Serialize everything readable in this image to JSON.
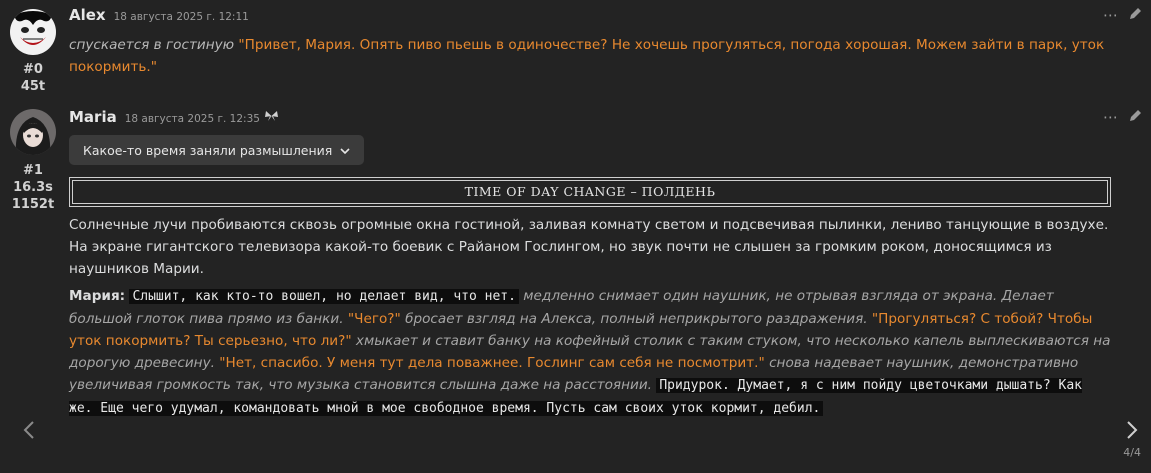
{
  "messages": [
    {
      "index": "#0",
      "tokens": "45t",
      "name": "Alex",
      "time": "18 августа 2025 г. 12:11",
      "action": "спускается в гостиную",
      "speech": "\"Привет, Мария. Опять пиво пьешь в одиночестве? Не хочешь прогуляться, погода хорошая. Можем зайти в парк, уток покормить.\""
    },
    {
      "index": "#1",
      "duration": "16.3s",
      "tokens": "1152t",
      "name": "Maria",
      "time": "18 августа 2025 г. 12:35",
      "extra_icon": "butterfly-icon",
      "reasoning_label": "Какое-то время заняли размышления",
      "tod_banner": "TIME OF DAY CHANGE – ПОЛДЕНЬ",
      "para1": "Солнечные лучи пробиваются сквозь огромные окна гостиной, заливая комнату светом и подсвечивая пылинки, лениво танцующие в воздухе. На экране гигантского телевизора какой-то боевик с Райаном Гослингом, но звук почти не слышен за громким роком, доносящимся из наушников Марии.",
      "speaker": "Мария:",
      "thought1": "Слышит, как кто-то вошел, но делает вид, что нет.",
      "act1": "медленно снимает один наушник, не отрывая взгляда от экрана. Делает большой глоток пива прямо из банки.",
      "say1": "\"Чего?\"",
      "act2": "бросает взгляд на Алекса, полный неприкрытого раздражения.",
      "say2": "\"Прогуляться? С тобой? Чтобы уток покормить? Ты серьезно, что ли?\"",
      "act3": "хмыкает и ставит банку на кофейный столик с таким стуком, что несколько капель выплескиваются на дорогую древесину.",
      "say3": "\"Нет, спасибо. У меня тут дела поважнее. Гослинг сам себя не посмотрит.\"",
      "act4": "снова надевает наушник, демонстративно увеличивая громкость так, что музыка становится слышна даже на расстоянии.",
      "thought2": "Придурок. Думает, я с ним пойду цветочками дышать? Как же. Еще чего удумал, командовать мной в мое свободное время. Пусть сам своих уток кормит, дебил."
    }
  ],
  "pagination": "4/4",
  "icons": {
    "more": "more-dots-icon",
    "edit": "pencil-icon",
    "prev": "chevron-left-icon",
    "next": "chevron-right-icon"
  }
}
